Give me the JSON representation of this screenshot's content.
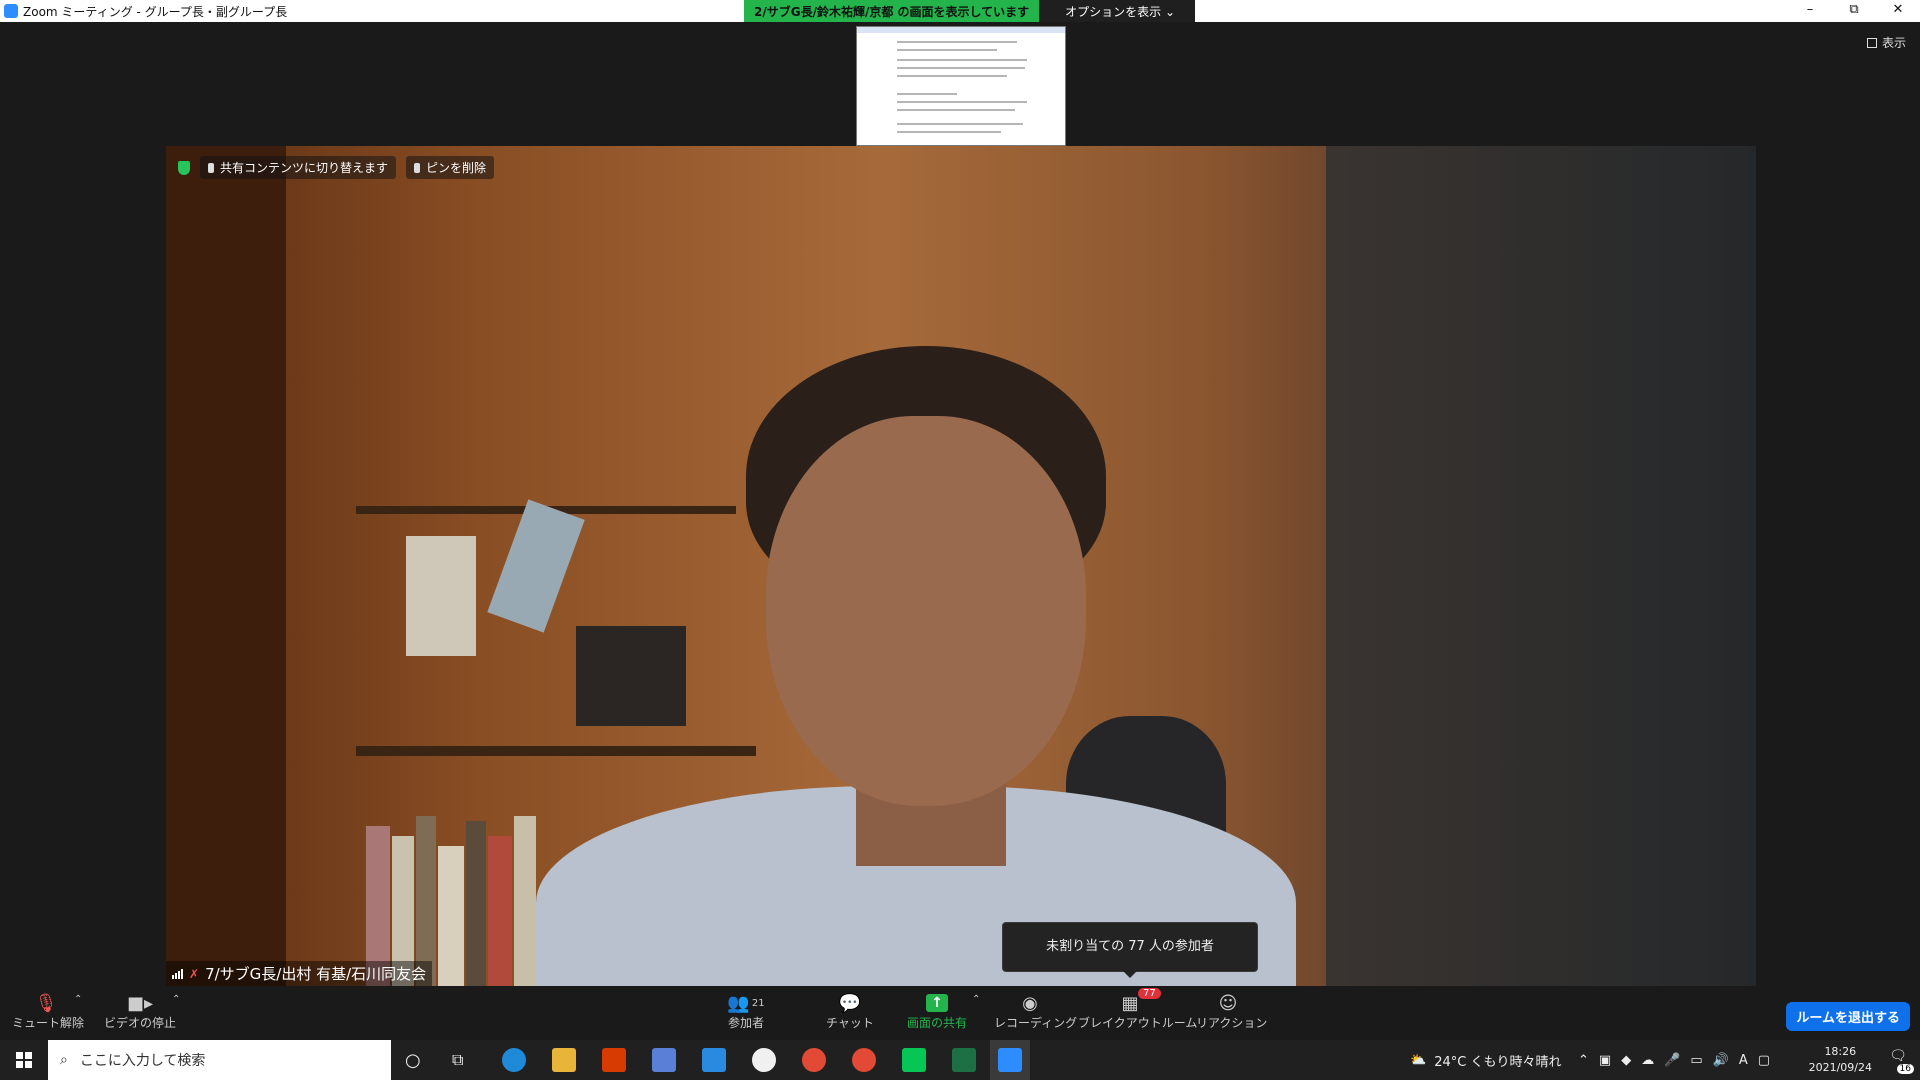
{
  "window": {
    "title": "Zoom ミーティング - グループ長・副グループ長",
    "share_banner": "2/サブG長/鈴木祐輝/京都 の画面を表示しています",
    "options_label": "オプションを表示",
    "minimize": "–",
    "restore": "⧉",
    "close": "✕"
  },
  "stage": {
    "view_label": "表示",
    "pin_switch_label": "共有コンテンツに切り替えます",
    "remove_pin_label": "ピンを削除",
    "participant_name": "7/サブG長/出村 有基/石川同友会",
    "tooltip": "未割り当ての 77 人の参加者"
  },
  "toolbar": {
    "unmute": "ミュート解除",
    "stop_video": "ビデオの停止",
    "participants": "参加者",
    "participants_count": "21",
    "chat": "チャット",
    "share_screen": "画面の共有",
    "recording": "レコーディング",
    "breakout": "ブレイクアウトルーム",
    "breakout_badge": "77",
    "reactions": "リアクション",
    "leave": "ルームを退出する"
  },
  "taskbar": {
    "search_placeholder": "ここに入力して検索",
    "weather": "24°C くもり時々晴れ",
    "time": "18:26",
    "date": "2021/09/24",
    "ime": "A",
    "notification_count": "16"
  },
  "colors": {
    "share_green": "#23b44b",
    "leave_blue": "#0e71eb",
    "badge_red": "#e0323b"
  }
}
